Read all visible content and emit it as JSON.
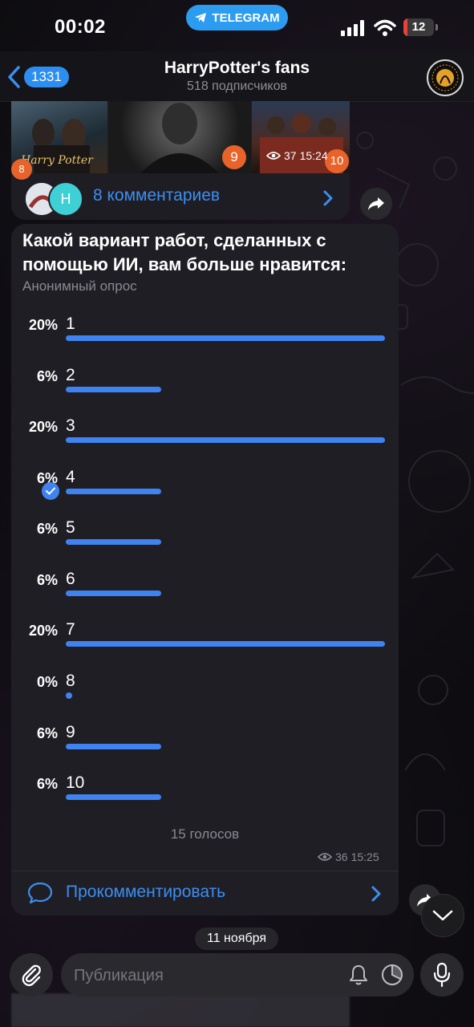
{
  "status_bar": {
    "time": "00:02",
    "telegram_label": "TELEGRAM",
    "battery": "12",
    "battery_level": 0.12
  },
  "header": {
    "back_count": "1331",
    "title": "HarryPotter's fans",
    "subtitle": "518 подписчиков",
    "avatar_text": "HARRYPOTTERFANS"
  },
  "media_message": {
    "badges": [
      "8",
      "9",
      "10"
    ],
    "image_caption": "Harry Potter",
    "views": "37",
    "time": "15:24",
    "comments_label": "8 комментариев",
    "avatar_letter": "Н"
  },
  "poll": {
    "question": "Какой вариант работ, сделанных с помощью ИИ, вам больше нравится:",
    "type": "Анонимный опрос",
    "options": [
      {
        "label": "1",
        "percent": "20%",
        "value": 20
      },
      {
        "label": "2",
        "percent": "6%",
        "value": 6
      },
      {
        "label": "3",
        "percent": "20%",
        "value": 20
      },
      {
        "label": "4",
        "percent": "6%",
        "value": 6,
        "chosen": true
      },
      {
        "label": "5",
        "percent": "6%",
        "value": 6
      },
      {
        "label": "6",
        "percent": "6%",
        "value": 6
      },
      {
        "label": "7",
        "percent": "20%",
        "value": 20
      },
      {
        "label": "8",
        "percent": "0%",
        "value": 0
      },
      {
        "label": "9",
        "percent": "6%",
        "value": 6
      },
      {
        "label": "10",
        "percent": "6%",
        "value": 6
      }
    ],
    "votes": "15 голосов",
    "views": "36",
    "time": "15:25",
    "comment_label": "Прокомментировать"
  },
  "date_pill": "11 ноября",
  "composer": {
    "placeholder": "Публикация"
  },
  "colors": {
    "accent": "#3e83f0",
    "link": "#3b8ff0",
    "bubble": "#201e25",
    "badge_orange": "#e8632a",
    "battery_red": "#e8433b"
  },
  "icons": [
    "telegram-icon",
    "signal-icon",
    "wifi-icon",
    "back-chevron-icon",
    "eye-icon",
    "chevron-right-icon",
    "share-icon",
    "check-icon",
    "comment-bubble-icon",
    "chevron-down-icon",
    "paperclip-icon",
    "bell-icon",
    "timer-icon",
    "microphone-icon"
  ]
}
